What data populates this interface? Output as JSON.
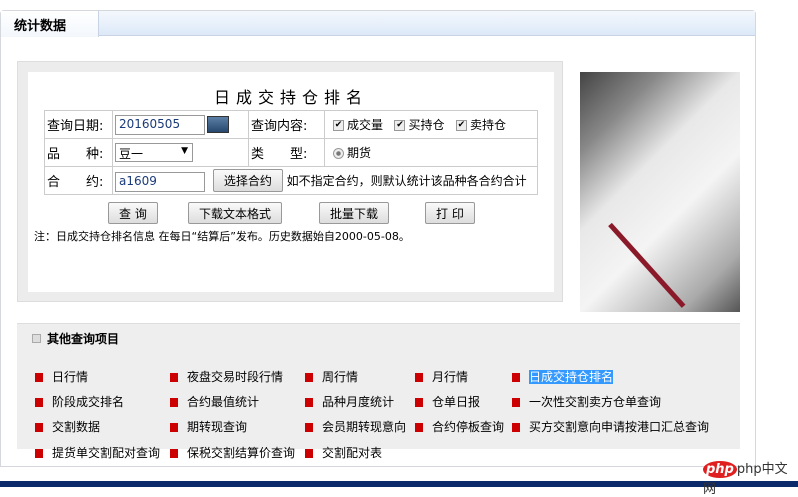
{
  "tab": "统计数据",
  "form": {
    "title": "日成交持仓排名",
    "date_label": "查询日期:",
    "date_value": "20160505",
    "content_label": "查询内容:",
    "checks": [
      {
        "label": "成交量",
        "checked": true
      },
      {
        "label": "买持仓",
        "checked": true
      },
      {
        "label": "卖持仓",
        "checked": true
      }
    ],
    "variety_label": "品　　种:",
    "variety_value": "豆一",
    "type_label": "类　　型:",
    "type_option": "期货",
    "contract_label": "合　　约:",
    "contract_value": "a1609",
    "select_contract": "选择合约",
    "contract_hint": "如不指定合约，则默认统计该品种各合约合计",
    "buttons": [
      "查 询",
      "下载文本格式",
      "批量下载",
      "打 印"
    ],
    "note": "注：日成交持仓排名信息 在每日“结算后”发布。历史数据始自2000-05-08。"
  },
  "other": {
    "heading": "其他查询项目",
    "links": [
      "日行情",
      "夜盘交易时段行情",
      "周行情",
      "月行情",
      "日成交持仓排名",
      "阶段成交排名",
      "合约最值统计",
      "品种月度统计",
      "仓单日报",
      "一次性交割卖方仓单查询",
      "交割数据",
      "期转现查询",
      "会员期转现意向",
      "合约停板查询",
      "买方交割意向申请按港口汇总查询",
      "提货单交割配对查询",
      "保税交割结算价查询",
      "交割配对表"
    ],
    "active": "日成交持仓排名"
  },
  "watermark": "php中文网"
}
